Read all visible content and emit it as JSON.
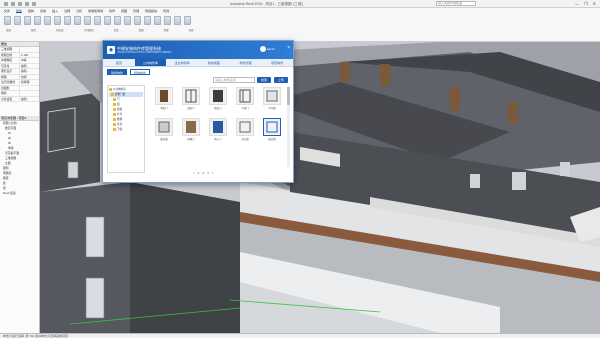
{
  "app": {
    "title": "Autodesk Revit 2018 - 项目1 - 三维视图: {三维}",
    "search_placeholder": "键入关键字或短语",
    "window_controls": [
      "—",
      "❐",
      "✕"
    ]
  },
  "ribbon": {
    "tabs": [
      "文件",
      "建筑",
      "结构",
      "系统",
      "插入",
      "注释",
      "分析",
      "体量和场地",
      "协作",
      "视图",
      "管理",
      "附加模块",
      "修改"
    ],
    "groups": [
      "选择",
      "属性",
      "剪贴板",
      "几何图形",
      "修改",
      "视图",
      "测量",
      "创建"
    ]
  },
  "left_panel": {
    "header": "属性",
    "rows": [
      [
        "三维视图",
        ""
      ],
      [
        "视图比例",
        "1:100"
      ],
      [
        "详细程度",
        "中等"
      ],
      [
        "可见性",
        "编辑..."
      ],
      [
        "图形显示",
        "编辑..."
      ],
      [
        "规程",
        "协调"
      ],
      [
        "显示隐藏线",
        "按规程"
      ],
      [
        "剖面框",
        ""
      ],
      [
        "相机",
        ""
      ],
      [
        "渲染设置",
        "编辑..."
      ]
    ],
    "browser_header": "项目浏览器 - 项目1",
    "tree": [
      "视图 (全部)",
      "楼层平面",
      "1F",
      "2F",
      "3F",
      "场地",
      "天花板平面",
      "三维视图",
      "立面",
      "图例",
      "明细表",
      "图纸",
      "族",
      "组",
      "Revit 链接"
    ]
  },
  "status": {
    "text": "单击可进行选择; 按 Tab 键并单击可选择其他项目"
  },
  "dialog": {
    "title": "中建安装构件库管理系统",
    "subtitle": "CSCEC INSTALLATION COMPONENT LIBRARY",
    "user": "admin",
    "nav": [
      "首页",
      "公共构件库",
      "企业构件库",
      "我的收藏",
      "构件管理",
      "项目构件"
    ],
    "nav_active": 1,
    "categories": [
      "建筑构件",
      "结构构件"
    ],
    "search_placeholder": "请输入构件名称",
    "search_btn": "搜索",
    "upload_btn": "上传",
    "tree": [
      "公共构件库",
      "建筑门窗",
      "门",
      "窗",
      "幕墙",
      "栏杆",
      "楼梯",
      "家具",
      "卫浴"
    ],
    "tree_selected": 1,
    "items": [
      "单扇门",
      "双扇门",
      "推拉门",
      "子母门",
      "平开窗",
      "推拉窗",
      "折叠门",
      "防火门",
      "百叶窗",
      "组合窗"
    ],
    "pager": [
      "<",
      "1",
      "2",
      "3",
      ">"
    ]
  }
}
